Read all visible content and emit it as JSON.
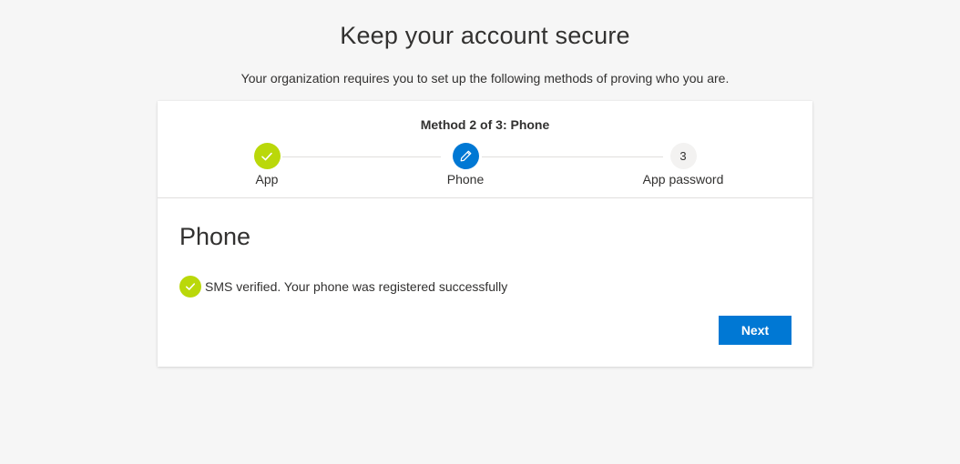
{
  "page": {
    "title": "Keep your account secure",
    "subtitle": "Your organization requires you to set up the following methods of proving who you are."
  },
  "wizard": {
    "method_header": "Method 2 of 3: Phone",
    "steps": [
      {
        "label": "App",
        "state": "completed",
        "icon": "checkmark-icon"
      },
      {
        "label": "Phone",
        "state": "current",
        "icon": "pencil-icon"
      },
      {
        "label": "App password",
        "state": "pending",
        "number": "3"
      }
    ]
  },
  "section": {
    "title": "Phone",
    "status_icon": "checkmark-icon",
    "status_text": "SMS verified. Your phone was registered successfully"
  },
  "actions": {
    "next_label": "Next"
  },
  "colors": {
    "accent": "#0078d4",
    "success": "#bad80a",
    "background": "#f6f6f6",
    "text": "#323130"
  }
}
